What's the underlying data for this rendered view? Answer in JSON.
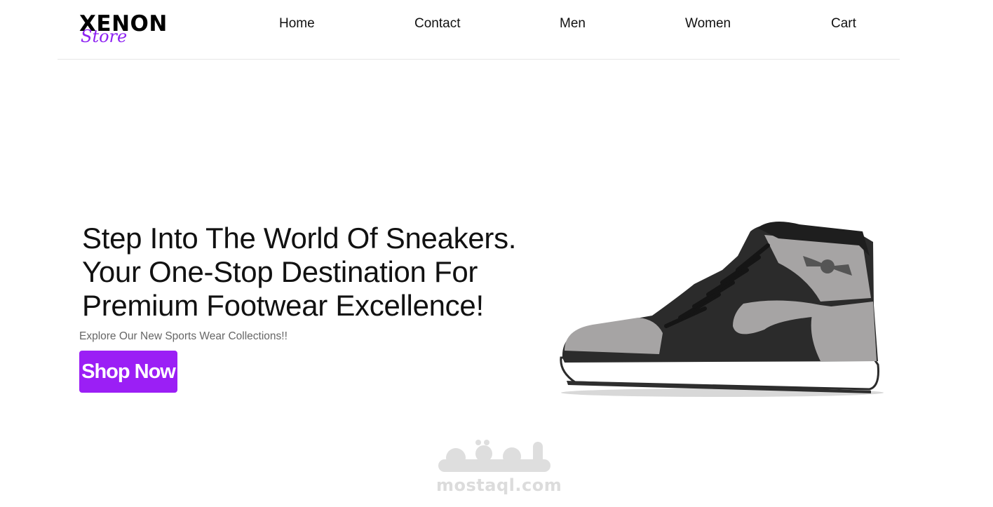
{
  "brand": {
    "name": "XENON",
    "tagline": "Store",
    "accent_color": "#9b1ff5"
  },
  "nav": {
    "items": [
      {
        "label": "Home"
      },
      {
        "label": "Contact"
      },
      {
        "label": "Men"
      },
      {
        "label": "Women"
      },
      {
        "label": "Cart"
      }
    ]
  },
  "hero": {
    "headline_lines": [
      "Step Into The World Of Sneakers.",
      "Your One-Stop Destination For",
      "Premium Footwear Excellence!"
    ],
    "subtitle": "Explore Our New Sports Wear Collections!!",
    "cta_label": "Shop Now",
    "image_icon": "sneaker-image"
  },
  "watermark": {
    "arabic": "مستقل",
    "domain": "mostaql.com"
  }
}
